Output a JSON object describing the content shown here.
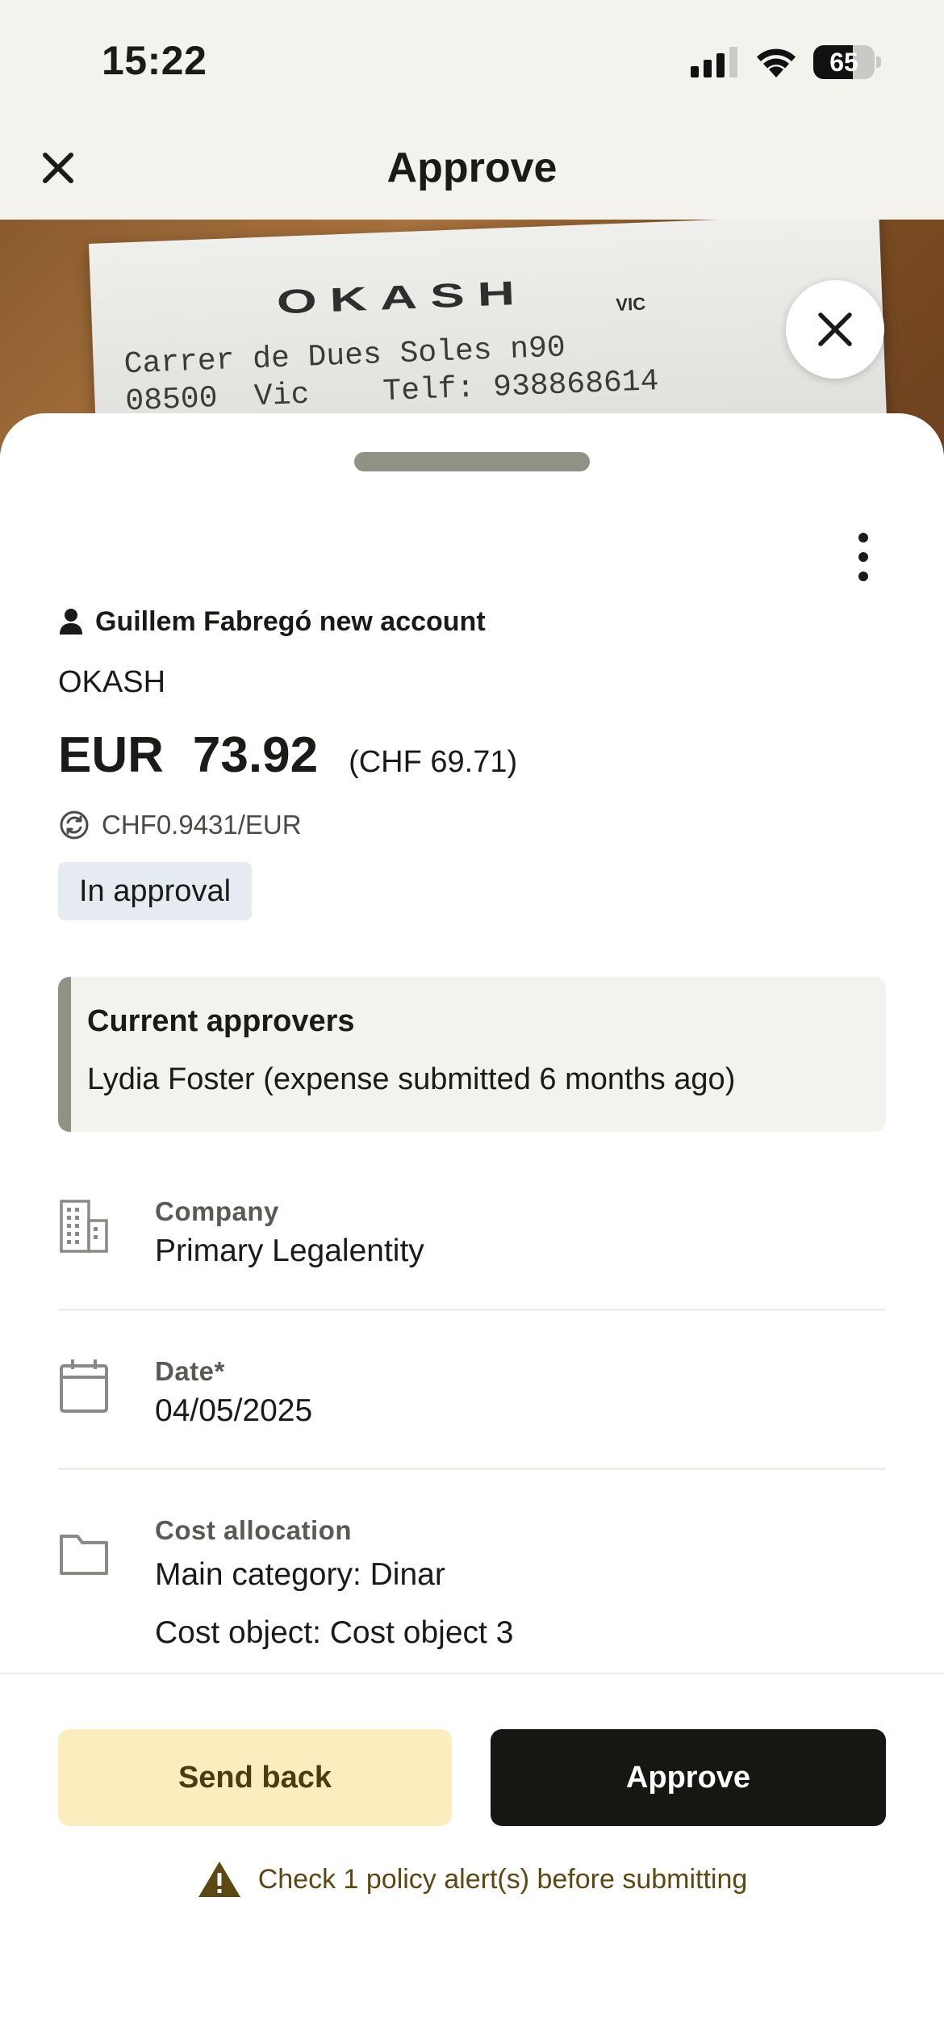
{
  "status_bar": {
    "time": "15:22",
    "battery_level": "65",
    "battery_fraction": 0.65
  },
  "header": {
    "title": "Approve"
  },
  "receipt_photo": {
    "brand": "OKASH",
    "brand_sub": "VIC",
    "line_1": "Carrer de Dues Soles n90",
    "line_2": "08500  Vic    Telf: 938868614"
  },
  "expense": {
    "account": "Guillem Fabregó new account",
    "merchant": "OKASH",
    "currency": "EUR",
    "amount": "73.92",
    "converted": "(CHF 69.71)",
    "exchange_rate": "CHF0.9431/EUR",
    "status": "In approval"
  },
  "approvers": {
    "title": "Current approvers",
    "text": "Lydia Foster (expense submitted 6 months ago)"
  },
  "fields": {
    "company": {
      "label": "Company",
      "value": "Primary Legalentity"
    },
    "date": {
      "label": "Date*",
      "value": "04/05/2025"
    },
    "cost_allocation": {
      "label": "Cost allocation",
      "main_category": "Main category: Dinar",
      "cost_object": "Cost object: Cost object 3"
    }
  },
  "actions": {
    "send_back": "Send back",
    "approve": "Approve",
    "policy_alert": "Check 1 policy alert(s) before submitting"
  },
  "colors": {
    "background": "#f3f2ec",
    "status_badge": "#e6ebf1",
    "send_back_bg": "#fbedbd",
    "approve_bg": "#161613",
    "alert_icon": "#5c4813"
  },
  "icons": {
    "header_close": "close-icon",
    "photo_close": "close-icon",
    "more": "more-vertical-icon",
    "account": "person-icon",
    "exchange": "currency-exchange-icon",
    "company": "building-icon",
    "date": "calendar-icon",
    "cost_allocation": "folder-icon",
    "alert": "warning-icon"
  }
}
